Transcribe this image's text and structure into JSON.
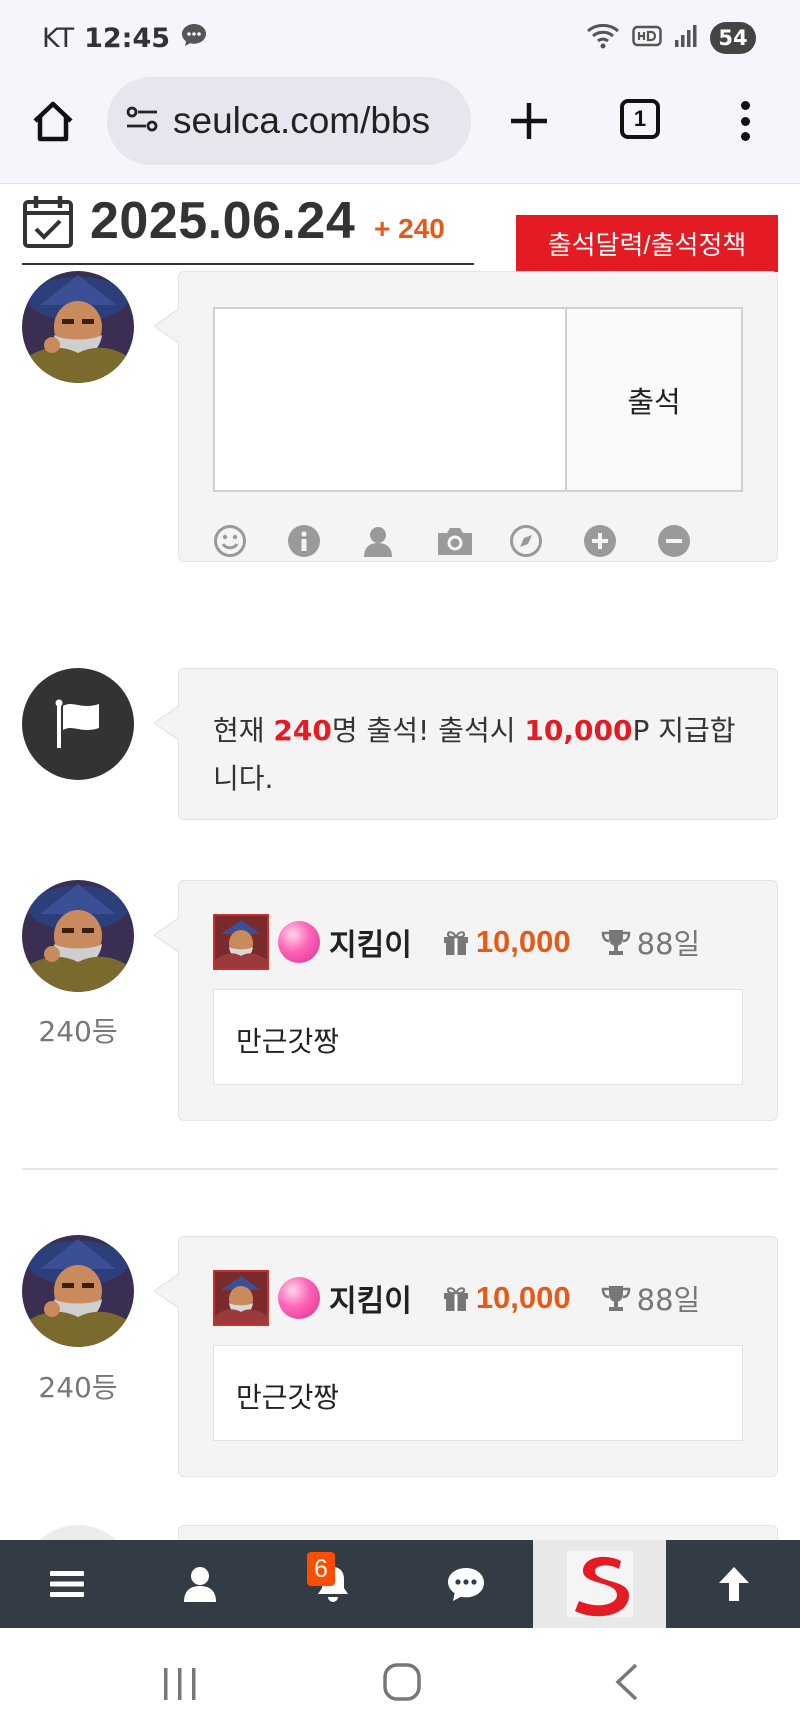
{
  "status_bar": {
    "carrier": "KT",
    "time": "12:45",
    "battery": "54"
  },
  "browser": {
    "url": "seulca.com/bbs",
    "tab_count": "1"
  },
  "attendance": {
    "date": "2025.06.24",
    "count_label": "+ 240",
    "calendar_button": "출석달력/출석정책",
    "attend_button": "출석",
    "comment_placeholder": "",
    "notice": {
      "prefix": "현재 ",
      "count": "240",
      "middle": "명 출석! 출석시 ",
      "points": "10,000",
      "suffix": "P 지급합니다."
    },
    "entries": [
      {
        "rank": "240등",
        "nickname": "지킴이",
        "points": "10,000",
        "days": "88일",
        "message": "만근갓짱"
      },
      {
        "rank": "240등",
        "nickname": "지킴이",
        "points": "10,000",
        "days": "88일",
        "message": "만근갓짱"
      }
    ]
  },
  "bottom_nav": {
    "notification_count": "6"
  },
  "icons": {
    "home": "home-icon",
    "site_settings": "tune-icon",
    "new_tab": "plus-icon",
    "menu": "more-vert-icon",
    "calendar": "calendar-check-icon",
    "notice": "flag-icon",
    "gift": "gift-icon",
    "trophy": "trophy-icon"
  },
  "colors": {
    "accent_red": "#e41b23",
    "points_orange": "#e65a19",
    "nav_bg": "#333b44"
  }
}
